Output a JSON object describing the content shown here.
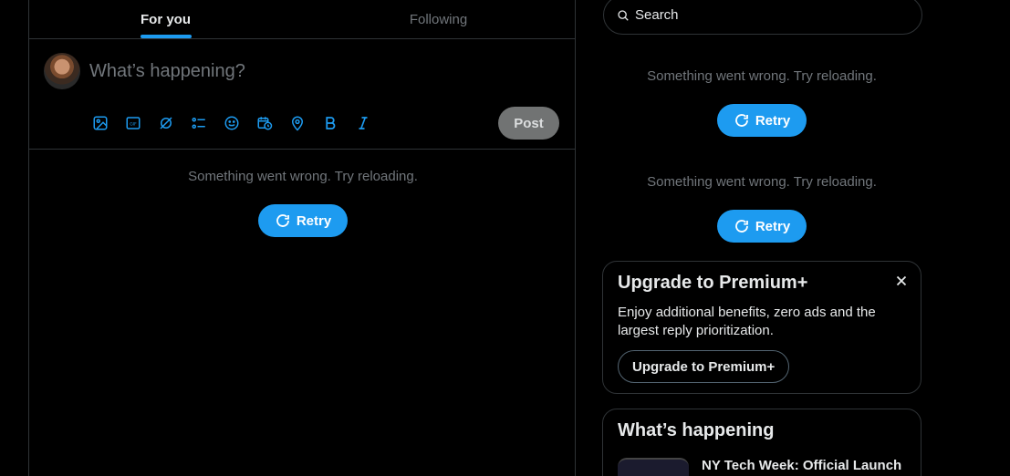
{
  "tabs": [
    {
      "label": "For you",
      "active": true
    },
    {
      "label": "Following",
      "active": false
    }
  ],
  "composer": {
    "placeholder": "What’s happening?",
    "post_label": "Post",
    "tools": [
      "media-icon",
      "gif-icon",
      "grok-icon",
      "poll-icon",
      "emoji-icon",
      "schedule-icon",
      "location-icon",
      "bold-icon",
      "italic-icon"
    ]
  },
  "feed_error": {
    "message": "Something went wrong. Try reloading.",
    "retry_label": "Retry"
  },
  "search": {
    "placeholder": "Search"
  },
  "sidebar_errors": [
    {
      "message": "Something went wrong. Try reloading.",
      "retry_label": "Retry"
    },
    {
      "message": "Something went wrong. Try reloading.",
      "retry_label": "Retry"
    }
  ],
  "premium": {
    "title": "Upgrade to Premium+",
    "body": "Enjoy additional benefits, zero ads and the largest reply prioritization.",
    "button_label": "Upgrade to Premium+"
  },
  "trending": {
    "title": "What’s happening",
    "items": [
      {
        "title": "NY Tech Week: Official Launch"
      }
    ]
  },
  "colors": {
    "accent": "#1d9bf0",
    "border": "#2f3336",
    "muted": "#71767b",
    "background": "#000000"
  }
}
